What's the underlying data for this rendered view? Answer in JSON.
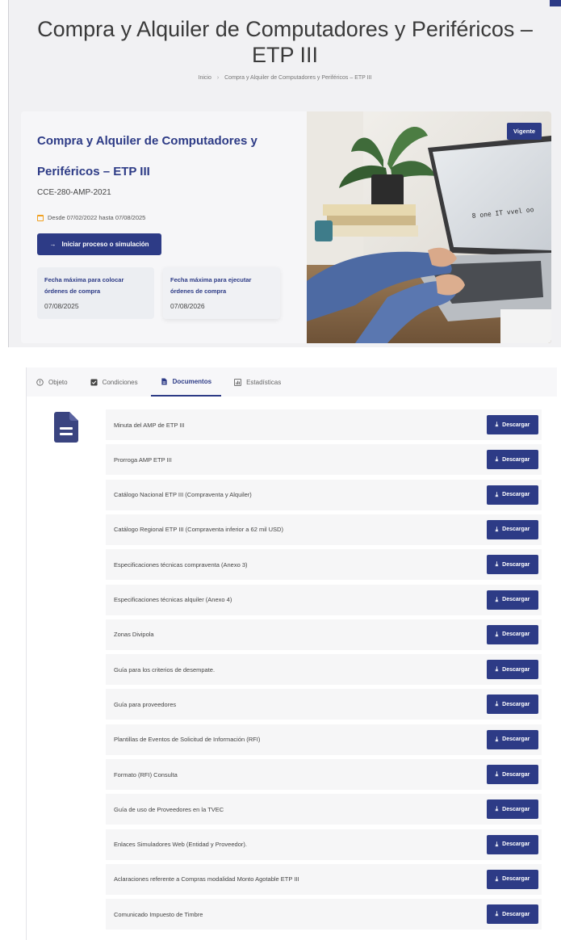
{
  "hero": {
    "title": "Compra y Alquiler de Computadores y Periféricos – ETP III",
    "breadcrumb": [
      "Inicio",
      "Compra y Alquiler de Computadores y Periféricos – ETP III"
    ]
  },
  "card": {
    "title": "Compra y Alquiler de Computadores y Periféricos – ETP III",
    "code": "CCE-280-AMP-2021",
    "date_range": "Desde 07/02/2022 hasta 07/08/2025",
    "start_button": "Iniciar proceso o simulación",
    "status_badge": "Vigente",
    "deadlines": [
      {
        "label": "Fecha máxima para colocar órdenes de compra",
        "value": "07/08/2025"
      },
      {
        "label": "Fecha máxima para ejecutar órdenes de compra",
        "value": "07/08/2026"
      }
    ]
  },
  "tabs": [
    {
      "label": "Objeto",
      "icon": "info-circle-icon",
      "active": false
    },
    {
      "label": "Condiciones",
      "icon": "checkbox-icon",
      "active": false
    },
    {
      "label": "Documentos",
      "icon": "document-icon",
      "active": true
    },
    {
      "label": "Estadísticas",
      "icon": "chart-icon",
      "active": false
    }
  ],
  "download_label": "Descargar",
  "documents": [
    "Minuta del AMP de ETP III",
    "Prorroga AMP ETP III",
    "Catálogo Nacional ETP III (Compraventa y Alquiler)",
    "Catálogo Regional ETP III (Compraventa inferior a 62 mil USD)",
    "Especificaciones técnicas compraventa (Anexo 3)",
    "Especificaciones técnicas alquiler (Anexo 4)",
    "Zonas Divipola",
    "Guía para los criterios de desempate.",
    "Guía para proveedores",
    "Plantillas de Eventos de Solicitud de Información (RFI)",
    "Formato (RFI) Consulta",
    "Guía de uso de Proveedores en la TVEC",
    "Enlaces Simuladores Web (Entidad y Proveedor).",
    "Aclaraciones referente a Compras modalidad Monto Agotable ETP III",
    "Comunicado Impuesto de Timbre"
  ],
  "colors": {
    "primary": "#2d3b86",
    "accent_calendar": "#f0a020",
    "row_bg": "#f6f6f7"
  }
}
